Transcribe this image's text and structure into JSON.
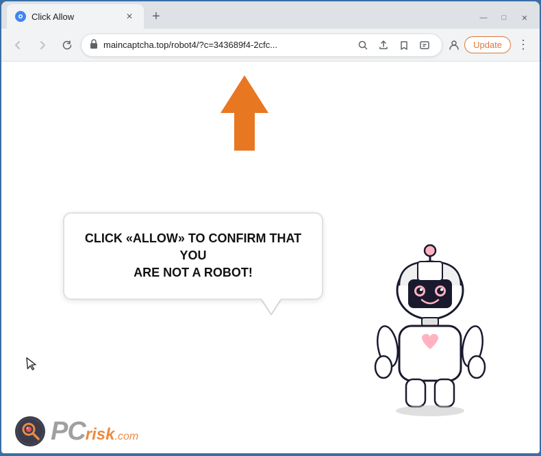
{
  "window": {
    "title": "Click Allow",
    "url": "maincaptcha.top/robot4/?c=343689f4-2cfc...",
    "url_full": "maincaptcha.top/robot4/?c=343689f4-2cfc...",
    "tab_title": "Click Allow"
  },
  "toolbar": {
    "back_label": "←",
    "forward_label": "→",
    "refresh_label": "↻",
    "lock_icon": "🔒",
    "update_btn": "Update",
    "menu_dots": "⋮"
  },
  "page": {
    "bubble_text_line1": "CLICK «ALLOW» TO CONFIRM THAT YOU",
    "bubble_text_line2": "ARE NOT A ROBOT!",
    "pcrisk_pc": "PC",
    "pcrisk_risk": "risk",
    "pcrisk_com": ".com"
  },
  "controls": {
    "minimize": "—",
    "maximize": "□",
    "close": "✕",
    "new_tab": "+"
  }
}
